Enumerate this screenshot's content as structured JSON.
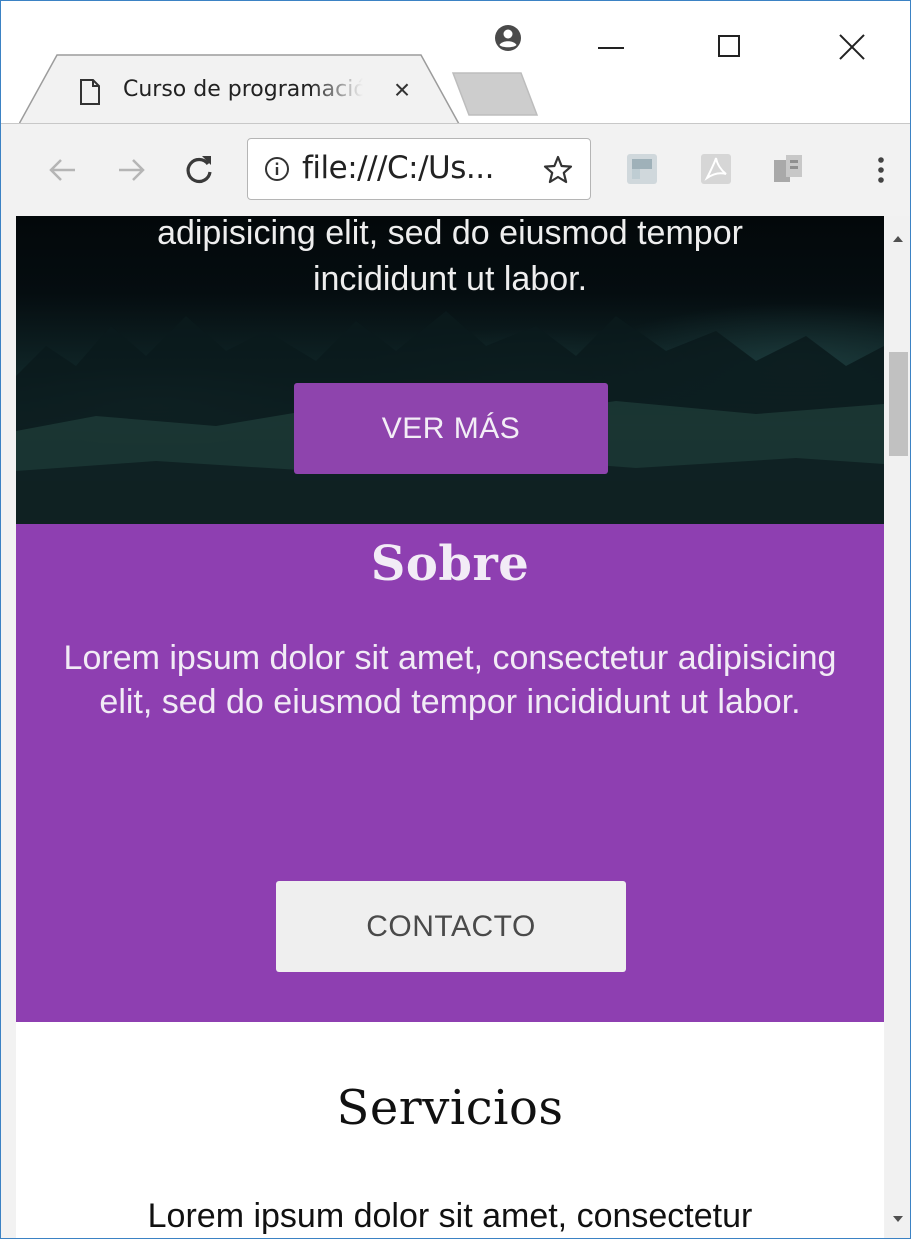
{
  "browser": {
    "tab_title": "Curso de programación",
    "tab_close_glyph": "×",
    "url": "file:///C:/Us...",
    "icons": {
      "profile": "profile-icon",
      "back": "back-arrow-icon",
      "forward": "forward-arrow-icon",
      "reload": "reload-icon",
      "info": "info-icon",
      "bookmark": "star-icon",
      "extensions": [
        "extension-icon",
        "pdf-extension-icon",
        "reader-extension-icon"
      ],
      "menu": "more-vertical-icon"
    }
  },
  "hero": {
    "line_1": "adipisicing elit, sed do eiusmod tempor",
    "line_2": "incididunt ut labor.",
    "button": "VER MÁS"
  },
  "sobre": {
    "title": "Sobre",
    "text": "Lorem ipsum dolor sit amet, consectetur adipisicing elit, sed do eiusmod tempor incididunt ut labor.",
    "button": "CONTACTO"
  },
  "servicios": {
    "title": "Servicios",
    "text": "Lorem ipsum dolor sit amet, consectetur"
  },
  "colors": {
    "accent": "#8e44ad",
    "section_bg": "#8e3fb1",
    "button_light": "#efefef"
  }
}
